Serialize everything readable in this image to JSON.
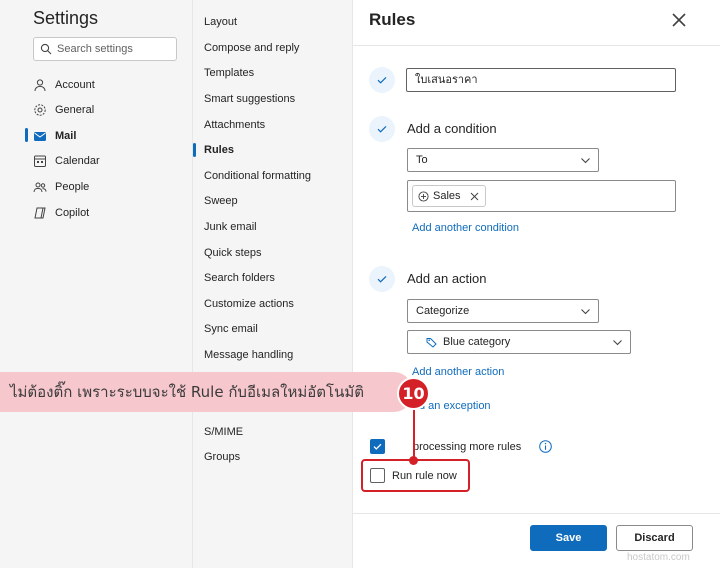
{
  "settings": {
    "title": "Settings",
    "search_placeholder": "Search settings",
    "nav": [
      {
        "label": "Account",
        "icon": "person-icon"
      },
      {
        "label": "General",
        "icon": "gear-icon"
      },
      {
        "label": "Mail",
        "icon": "mail-icon"
      },
      {
        "label": "Calendar",
        "icon": "calendar-icon"
      },
      {
        "label": "People",
        "icon": "people-icon"
      },
      {
        "label": "Copilot",
        "icon": "copilot-icon"
      }
    ],
    "active_nav": "Mail"
  },
  "mail_menu": {
    "items": [
      "Layout",
      "Compose and reply",
      "Templates",
      "Smart suggestions",
      "Attachments",
      "Rules",
      "Conditional formatting",
      "Sweep",
      "Junk email",
      "Quick steps",
      "Search folders",
      "Customize actions",
      "Sync email",
      "Message handling",
      "S/MIME",
      "Groups"
    ],
    "active": "Rules"
  },
  "rules": {
    "title": "Rules",
    "rule_name": "ใบเสนอราคา",
    "condition_heading": "Add a condition",
    "condition_field": "To",
    "condition_tag": "Sales",
    "add_another_condition": "Add another condition",
    "action_heading": "Add an action",
    "action_field": "Categorize",
    "action_value": "Blue category",
    "add_another_action": "Add another action",
    "add_exception_partial": "d an exception",
    "stop_processing_partial": "processing more rules",
    "stop_processing_checked": true,
    "run_rule_now": "Run rule now",
    "run_rule_now_checked": false,
    "save_label": "Save",
    "discard_label": "Discard"
  },
  "annotation": {
    "text": "ไม่ต้องติ๊ก เพราะระบบจะใช้ Rule กับอีเมลใหม่อัตโนมัติ",
    "step_number": "10",
    "color": "#d42027",
    "banner_color": "#f6c7cd"
  },
  "watermark": "hostatom.com",
  "colors": {
    "accent": "#0f6cbd"
  }
}
